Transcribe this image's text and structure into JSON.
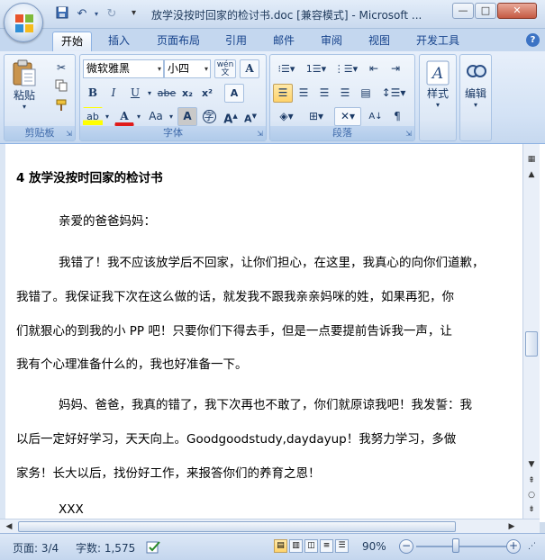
{
  "window": {
    "title": "放学没按时回家的检讨书.doc [兼容模式] - Microsoft ...",
    "minimize": "—",
    "maximize": "□",
    "close": "✕"
  },
  "quick_access": {
    "save_icon": "save-icon",
    "undo": "↶",
    "redo": "↻",
    "more": "▾"
  },
  "tabs": [
    {
      "label": "开始",
      "active": true
    },
    {
      "label": "插入"
    },
    {
      "label": "页面布局"
    },
    {
      "label": "引用"
    },
    {
      "label": "邮件"
    },
    {
      "label": "审阅"
    },
    {
      "label": "视图"
    },
    {
      "label": "开发工具"
    }
  ],
  "help": "?",
  "ribbon": {
    "clipboard": {
      "label": "剪贴板",
      "paste": "粘贴"
    },
    "font": {
      "label": "字体",
      "font_name": "微软雅黑",
      "font_size": "小四",
      "bold": "B",
      "italic": "I",
      "underline": "U",
      "strike": "abe",
      "subscript": "x₂",
      "superscript": "x²",
      "clear": "A",
      "highlight": "ab",
      "font_color": "A",
      "change_case": "Aa",
      "char_shading": "A",
      "enclose": "字",
      "grow": "A",
      "shrink": "A",
      "phonetic": "wén",
      "border": "A"
    },
    "paragraph": {
      "label": "段落"
    },
    "styles": {
      "label": "样式"
    },
    "editing": {
      "label": "编辑"
    }
  },
  "document": {
    "lines": [
      "4 放学没按时回家的检讨书",
      "亲爱的爸爸妈妈：",
      "我错了！我不应该放学后不回家，让你们担心，在这里，我真心的向你们道歉，",
      "我错了。我保证我下次在这么做的话，就发我不跟我亲亲妈咪的姓，如果再犯，你",
      "们就狠心的到我的小 PP 吧！只要你们下得去手，但是一点要提前告诉我一声，让",
      "我有个心理准备什么的，我也好准备一下。",
      "妈妈、爸爸，我真的错了，我下次再也不敢了，你们就原谅我吧！我发誓：我",
      "以后一定好好学习，天天向上。Goodgoodstudy,daydayup！我努力学习，多做",
      "家务！长大以后，找份好工作，来报答你们的养育之恩！",
      "XXX"
    ]
  },
  "status": {
    "page": "页面: 3/4",
    "words": "字数: 1,575",
    "zoom": "90%",
    "zoom_level_percent": 90
  }
}
